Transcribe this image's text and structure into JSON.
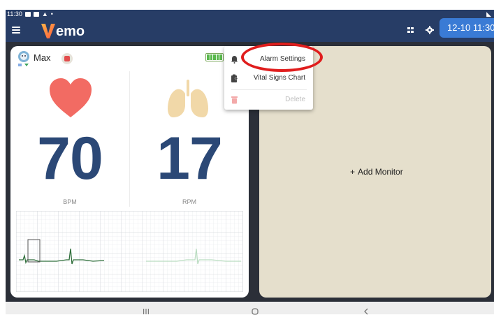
{
  "status_bar": {
    "time": "11:30",
    "right_icon": "signal-icon"
  },
  "app_bar": {
    "logo_text": "emo",
    "clock": "12-10 11:30"
  },
  "monitor": {
    "patient_name": "Max",
    "heart_rate": {
      "value": "70",
      "unit": "BPM"
    },
    "resp_rate": {
      "value": "17",
      "unit": "RPM"
    },
    "battery_level": 1.0
  },
  "context_menu": {
    "items": [
      {
        "label": "Alarm Settings",
        "icon": "bell-icon"
      },
      {
        "label": "Vital Signs Chart",
        "icon": "clipboard-heart-icon"
      },
      {
        "label": "Delete",
        "icon": "trash-icon"
      }
    ]
  },
  "add_monitor": {
    "label": "Add Monitor"
  },
  "colors": {
    "appbar": "#273d66",
    "clock_pill": "#3a7bd5",
    "vital_number": "#2b4876",
    "heart": "#f26b63",
    "lungs": "#f1d8a8",
    "highlight_ring": "#e01d1d",
    "add_panel": "#e5dfcc"
  }
}
